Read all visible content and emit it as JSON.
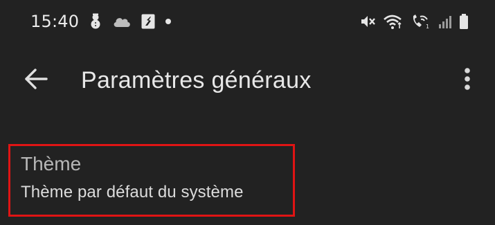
{
  "status_bar": {
    "time": "15:40",
    "left_icons": [
      "snowman-icon",
      "cloud-icon",
      "app-notification-icon",
      "dot-icon"
    ],
    "right_icons": [
      "mute-icon",
      "wifi-icon",
      "wifi-calling-icon",
      "signal-icon",
      "battery-icon"
    ]
  },
  "app_bar": {
    "title": "Paramètres généraux",
    "back_icon": "arrow-back-icon",
    "menu_icon": "more-vert-icon"
  },
  "settings": {
    "theme": {
      "title": "Thème",
      "value": "Thème par défaut du système"
    }
  },
  "colors": {
    "background": "#222222",
    "highlight_border": "#e01414",
    "text_primary": "#e8e8e8",
    "text_secondary": "#b8b8b8"
  }
}
